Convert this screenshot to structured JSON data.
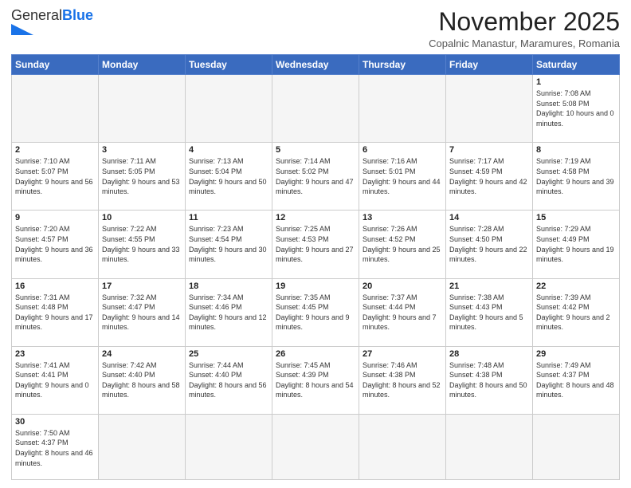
{
  "header": {
    "logo": {
      "text_general": "General",
      "text_blue": "Blue"
    },
    "title": "November 2025",
    "subtitle": "Copalnic Manastur, Maramures, Romania"
  },
  "weekdays": [
    "Sunday",
    "Monday",
    "Tuesday",
    "Wednesday",
    "Thursday",
    "Friday",
    "Saturday"
  ],
  "weeks": [
    [
      {
        "day": "",
        "info": "",
        "empty": true
      },
      {
        "day": "",
        "info": "",
        "empty": true
      },
      {
        "day": "",
        "info": "",
        "empty": true
      },
      {
        "day": "",
        "info": "",
        "empty": true
      },
      {
        "day": "",
        "info": "",
        "empty": true
      },
      {
        "day": "",
        "info": "",
        "empty": true
      },
      {
        "day": "1",
        "info": "Sunrise: 7:08 AM\nSunset: 5:08 PM\nDaylight: 10 hours and 0 minutes."
      }
    ],
    [
      {
        "day": "2",
        "info": "Sunrise: 7:10 AM\nSunset: 5:07 PM\nDaylight: 9 hours and 56 minutes."
      },
      {
        "day": "3",
        "info": "Sunrise: 7:11 AM\nSunset: 5:05 PM\nDaylight: 9 hours and 53 minutes."
      },
      {
        "day": "4",
        "info": "Sunrise: 7:13 AM\nSunset: 5:04 PM\nDaylight: 9 hours and 50 minutes."
      },
      {
        "day": "5",
        "info": "Sunrise: 7:14 AM\nSunset: 5:02 PM\nDaylight: 9 hours and 47 minutes."
      },
      {
        "day": "6",
        "info": "Sunrise: 7:16 AM\nSunset: 5:01 PM\nDaylight: 9 hours and 44 minutes."
      },
      {
        "day": "7",
        "info": "Sunrise: 7:17 AM\nSunset: 4:59 PM\nDaylight: 9 hours and 42 minutes."
      },
      {
        "day": "8",
        "info": "Sunrise: 7:19 AM\nSunset: 4:58 PM\nDaylight: 9 hours and 39 minutes."
      }
    ],
    [
      {
        "day": "9",
        "info": "Sunrise: 7:20 AM\nSunset: 4:57 PM\nDaylight: 9 hours and 36 minutes."
      },
      {
        "day": "10",
        "info": "Sunrise: 7:22 AM\nSunset: 4:55 PM\nDaylight: 9 hours and 33 minutes."
      },
      {
        "day": "11",
        "info": "Sunrise: 7:23 AM\nSunset: 4:54 PM\nDaylight: 9 hours and 30 minutes."
      },
      {
        "day": "12",
        "info": "Sunrise: 7:25 AM\nSunset: 4:53 PM\nDaylight: 9 hours and 27 minutes."
      },
      {
        "day": "13",
        "info": "Sunrise: 7:26 AM\nSunset: 4:52 PM\nDaylight: 9 hours and 25 minutes."
      },
      {
        "day": "14",
        "info": "Sunrise: 7:28 AM\nSunset: 4:50 PM\nDaylight: 9 hours and 22 minutes."
      },
      {
        "day": "15",
        "info": "Sunrise: 7:29 AM\nSunset: 4:49 PM\nDaylight: 9 hours and 19 minutes."
      }
    ],
    [
      {
        "day": "16",
        "info": "Sunrise: 7:31 AM\nSunset: 4:48 PM\nDaylight: 9 hours and 17 minutes."
      },
      {
        "day": "17",
        "info": "Sunrise: 7:32 AM\nSunset: 4:47 PM\nDaylight: 9 hours and 14 minutes."
      },
      {
        "day": "18",
        "info": "Sunrise: 7:34 AM\nSunset: 4:46 PM\nDaylight: 9 hours and 12 minutes."
      },
      {
        "day": "19",
        "info": "Sunrise: 7:35 AM\nSunset: 4:45 PM\nDaylight: 9 hours and 9 minutes."
      },
      {
        "day": "20",
        "info": "Sunrise: 7:37 AM\nSunset: 4:44 PM\nDaylight: 9 hours and 7 minutes."
      },
      {
        "day": "21",
        "info": "Sunrise: 7:38 AM\nSunset: 4:43 PM\nDaylight: 9 hours and 5 minutes."
      },
      {
        "day": "22",
        "info": "Sunrise: 7:39 AM\nSunset: 4:42 PM\nDaylight: 9 hours and 2 minutes."
      }
    ],
    [
      {
        "day": "23",
        "info": "Sunrise: 7:41 AM\nSunset: 4:41 PM\nDaylight: 9 hours and 0 minutes."
      },
      {
        "day": "24",
        "info": "Sunrise: 7:42 AM\nSunset: 4:40 PM\nDaylight: 8 hours and 58 minutes."
      },
      {
        "day": "25",
        "info": "Sunrise: 7:44 AM\nSunset: 4:40 PM\nDaylight: 8 hours and 56 minutes."
      },
      {
        "day": "26",
        "info": "Sunrise: 7:45 AM\nSunset: 4:39 PM\nDaylight: 8 hours and 54 minutes."
      },
      {
        "day": "27",
        "info": "Sunrise: 7:46 AM\nSunset: 4:38 PM\nDaylight: 8 hours and 52 minutes."
      },
      {
        "day": "28",
        "info": "Sunrise: 7:48 AM\nSunset: 4:38 PM\nDaylight: 8 hours and 50 minutes."
      },
      {
        "day": "29",
        "info": "Sunrise: 7:49 AM\nSunset: 4:37 PM\nDaylight: 8 hours and 48 minutes."
      }
    ],
    [
      {
        "day": "30",
        "info": "Sunrise: 7:50 AM\nSunset: 4:37 PM\nDaylight: 8 hours and 46 minutes.",
        "last": true
      },
      {
        "day": "",
        "info": "",
        "empty": true,
        "last": true
      },
      {
        "day": "",
        "info": "",
        "empty": true,
        "last": true
      },
      {
        "day": "",
        "info": "",
        "empty": true,
        "last": true
      },
      {
        "day": "",
        "info": "",
        "empty": true,
        "last": true
      },
      {
        "day": "",
        "info": "",
        "empty": true,
        "last": true
      },
      {
        "day": "",
        "info": "",
        "empty": true,
        "last": true
      }
    ]
  ]
}
